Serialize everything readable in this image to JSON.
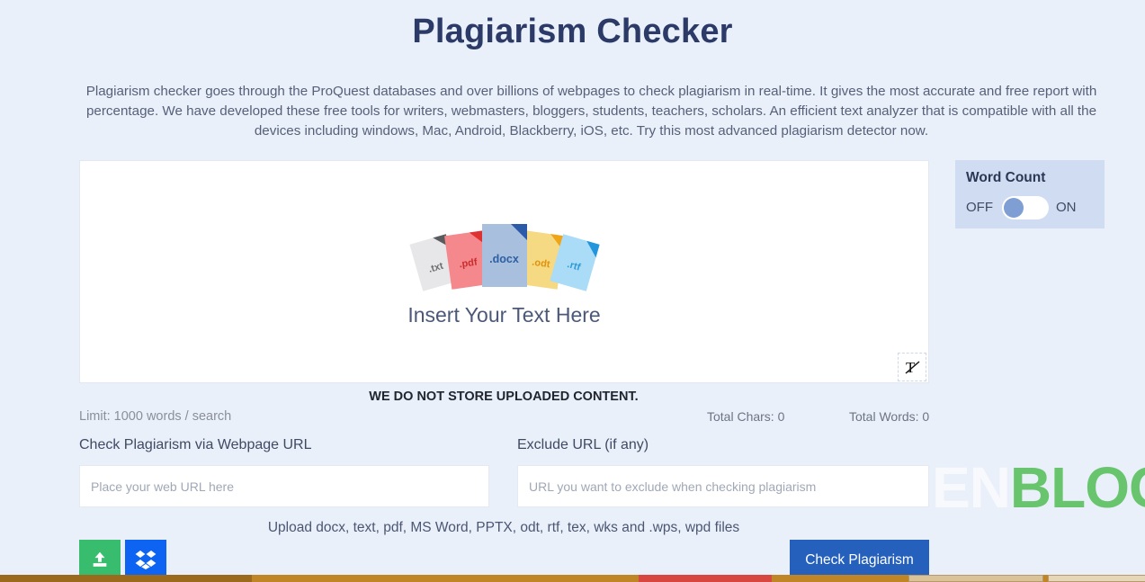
{
  "page": {
    "title": "Plagiarism Checker",
    "description": "Plagiarism checker goes through the ProQuest databases and over billions of webpages to check plagiarism in real-time. It gives the most accurate and free report with percentage. We have developed these free tools for writers, webmasters, bloggers, students, teachers, scholars. An efficient text analyzer that is compatible with all the devices including windows, Mac, Android, Blackberry, iOS, etc. Try this most advanced plagiarism detector now."
  },
  "watermark": {
    "part_white": "REMIEN",
    "part_green": "BLOG"
  },
  "editor": {
    "placeholder_text": "Insert Your Text Here",
    "clear_format_icon": "clear-formatting-icon",
    "file_types": [
      {
        "label": ".txt",
        "color": "#e7e7e9"
      },
      {
        "label": ".pdf",
        "color": "#f4888c"
      },
      {
        "label": ".docx",
        "color": "#a8bfdd"
      },
      {
        "label": ".odt",
        "color": "#f5d983"
      },
      {
        "label": ".rtf",
        "color": "#aadcf7"
      }
    ]
  },
  "notices": {
    "no_store": "WE DO NOT STORE UPLOADED CONTENT.",
    "limit": "Limit: 1000 words / search",
    "total_chars": "Total Chars: 0",
    "total_words": "Total Words: 0",
    "upload_formats": "Upload docx, text, pdf, MS Word, PPTX, odt, rtf, tex, wks and .wps, wpd files"
  },
  "fields": {
    "webpage_url": {
      "label": "Check Plagiarism via Webpage URL",
      "placeholder": "Place your web URL here",
      "value": ""
    },
    "exclude_url": {
      "label": "Exclude URL (if any)",
      "placeholder": "URL you want to exclude when checking plagiarism",
      "value": ""
    }
  },
  "word_count": {
    "title": "Word Count",
    "off_label": "OFF",
    "on_label": "ON",
    "state": "OFF"
  },
  "actions": {
    "upload_icon": "upload-icon",
    "dropbox_icon": "dropbox-icon",
    "check_plagiarism": "Check Plagiarism"
  },
  "colors": {
    "background": "#eaf0fa",
    "title": "#2b3a67",
    "primary_button": "#2560bd",
    "upload_button": "#38bd6f",
    "dropbox_button": "#0d64f2",
    "panel": "#cfdcf2",
    "watermark_green": "#57c05a"
  }
}
